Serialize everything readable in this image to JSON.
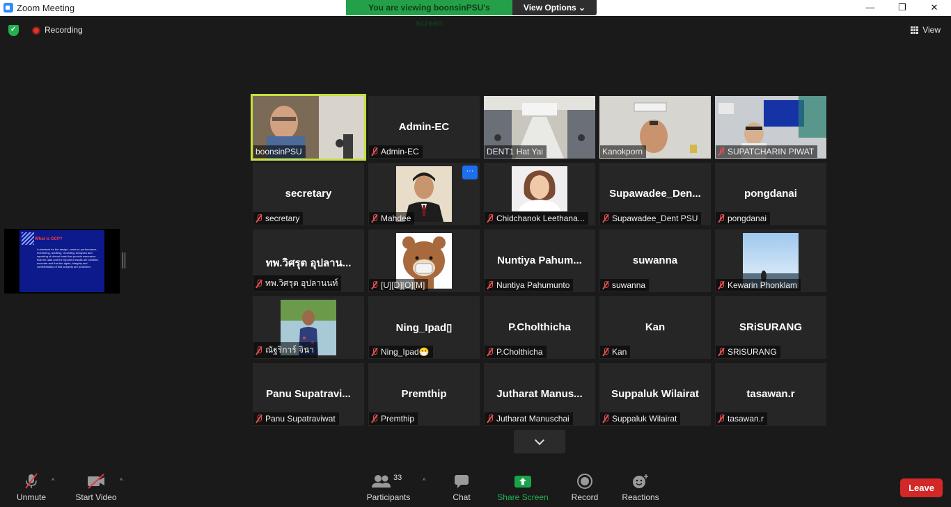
{
  "window": {
    "title": "Zoom Meeting",
    "minimize": "—",
    "restore": "❐",
    "close": "✕"
  },
  "banner": {
    "message": "You are viewing boonsinPSU's screen",
    "view_options": "View Options ⌄"
  },
  "topbar": {
    "recording": "Recording",
    "view": "View"
  },
  "tiles": [
    {
      "name": "boonsinPSU",
      "display": "",
      "type": "video",
      "active": true
    },
    {
      "name": "Admin-EC",
      "display": "Admin-EC",
      "type": "name"
    },
    {
      "name": "DENT1 Hat Yai",
      "display": "",
      "type": "video"
    },
    {
      "name": "Kanokporn",
      "display": "",
      "type": "video"
    },
    {
      "name": "SUPATCHARIN PIWAT",
      "display": "",
      "type": "video"
    },
    {
      "name": "secretary",
      "display": "secretary",
      "type": "name"
    },
    {
      "name": "Mahdee",
      "display": "",
      "type": "photo"
    },
    {
      "name": "Chidchanok Leethana...",
      "display": "",
      "type": "photo"
    },
    {
      "name": "Supawadee_Dent PSU",
      "display": "Supawadee_Den...",
      "type": "name"
    },
    {
      "name": "pongdanai",
      "display": "pongdanai",
      "type": "name"
    },
    {
      "name": "ทพ.วิศรุต อุปลานนท์",
      "display": "ทพ.วิศรุต อุปลาน...",
      "type": "name"
    },
    {
      "name": "[U][D][O][M]",
      "display": "",
      "type": "photo"
    },
    {
      "name": "Nuntiya Pahumunto",
      "display": "Nuntiya  Pahum...",
      "type": "name"
    },
    {
      "name": "suwanna",
      "display": "suwanna",
      "type": "name"
    },
    {
      "name": "Kewarin Phonklam",
      "display": "",
      "type": "photo"
    },
    {
      "name": "ณัฐริการ์ จินา",
      "display": "",
      "type": "photo"
    },
    {
      "name": "Ning_Ipad😷",
      "display": "Ning_Ipad▯",
      "type": "name"
    },
    {
      "name": "P.Cholthicha",
      "display": "P.Cholthicha",
      "type": "name"
    },
    {
      "name": "Kan",
      "display": "Kan",
      "type": "name"
    },
    {
      "name": "SRiSURANG",
      "display": "SRiSURANG",
      "type": "name"
    },
    {
      "name": "Panu Supatraviwat",
      "display": "Panu  Supatravi...",
      "type": "name"
    },
    {
      "name": "Premthip",
      "display": "Premthip",
      "type": "name"
    },
    {
      "name": "Jutharat Manuschai",
      "display": "Jutharat  Manus...",
      "type": "name"
    },
    {
      "name": "Suppaluk Wilairat",
      "display": "Suppaluk Wilairat",
      "type": "name"
    },
    {
      "name": "tasawan.r",
      "display": "tasawan.r",
      "type": "name"
    }
  ],
  "more_button": "···",
  "shared_slide": {
    "title": "What is GCP?",
    "body": "A standard for the design, conduct, performance, monitoring, auditing, recording, analyses and reporting of clinical trials that provide assurance that the data and the reported results are credible, accurate and that the rights, integrity and confidentiality of trial subjects are protected."
  },
  "toolbar": {
    "unmute": "Unmute",
    "start_video": "Start Video",
    "participants": "Participants",
    "participant_count": "33",
    "chat": "Chat",
    "share_screen": "Share Screen",
    "record": "Record",
    "reactions": "Reactions",
    "leave": "Leave",
    "caret": "^"
  },
  "colors": {
    "accent_green": "#24a148",
    "active_outline": "#c4e040",
    "leave_red": "#d22828",
    "share_green": "#1aa34a"
  }
}
